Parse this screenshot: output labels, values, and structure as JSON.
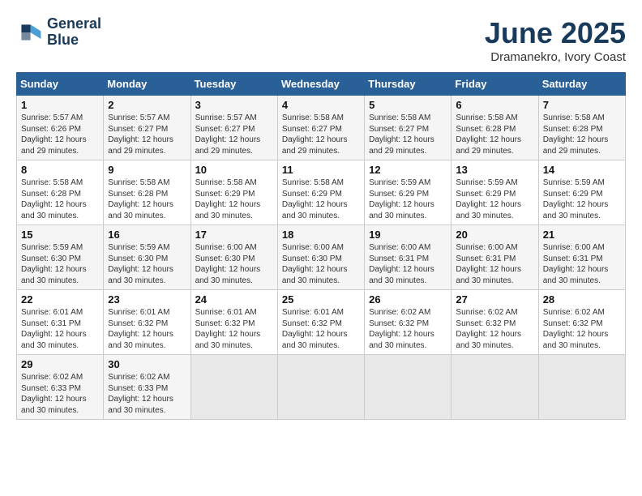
{
  "header": {
    "logo_line1": "General",
    "logo_line2": "Blue",
    "title": "June 2025",
    "subtitle": "Dramanekro, Ivory Coast"
  },
  "days_of_week": [
    "Sunday",
    "Monday",
    "Tuesday",
    "Wednesday",
    "Thursday",
    "Friday",
    "Saturday"
  ],
  "weeks": [
    [
      {
        "day": "1",
        "sunrise": "5:57 AM",
        "sunset": "6:26 PM",
        "daylight": "12 hours and 29 minutes."
      },
      {
        "day": "2",
        "sunrise": "5:57 AM",
        "sunset": "6:27 PM",
        "daylight": "12 hours and 29 minutes."
      },
      {
        "day": "3",
        "sunrise": "5:57 AM",
        "sunset": "6:27 PM",
        "daylight": "12 hours and 29 minutes."
      },
      {
        "day": "4",
        "sunrise": "5:58 AM",
        "sunset": "6:27 PM",
        "daylight": "12 hours and 29 minutes."
      },
      {
        "day": "5",
        "sunrise": "5:58 AM",
        "sunset": "6:27 PM",
        "daylight": "12 hours and 29 minutes."
      },
      {
        "day": "6",
        "sunrise": "5:58 AM",
        "sunset": "6:28 PM",
        "daylight": "12 hours and 29 minutes."
      },
      {
        "day": "7",
        "sunrise": "5:58 AM",
        "sunset": "6:28 PM",
        "daylight": "12 hours and 29 minutes."
      }
    ],
    [
      {
        "day": "8",
        "sunrise": "5:58 AM",
        "sunset": "6:28 PM",
        "daylight": "12 hours and 30 minutes."
      },
      {
        "day": "9",
        "sunrise": "5:58 AM",
        "sunset": "6:28 PM",
        "daylight": "12 hours and 30 minutes."
      },
      {
        "day": "10",
        "sunrise": "5:58 AM",
        "sunset": "6:29 PM",
        "daylight": "12 hours and 30 minutes."
      },
      {
        "day": "11",
        "sunrise": "5:58 AM",
        "sunset": "6:29 PM",
        "daylight": "12 hours and 30 minutes."
      },
      {
        "day": "12",
        "sunrise": "5:59 AM",
        "sunset": "6:29 PM",
        "daylight": "12 hours and 30 minutes."
      },
      {
        "day": "13",
        "sunrise": "5:59 AM",
        "sunset": "6:29 PM",
        "daylight": "12 hours and 30 minutes."
      },
      {
        "day": "14",
        "sunrise": "5:59 AM",
        "sunset": "6:29 PM",
        "daylight": "12 hours and 30 minutes."
      }
    ],
    [
      {
        "day": "15",
        "sunrise": "5:59 AM",
        "sunset": "6:30 PM",
        "daylight": "12 hours and 30 minutes."
      },
      {
        "day": "16",
        "sunrise": "5:59 AM",
        "sunset": "6:30 PM",
        "daylight": "12 hours and 30 minutes."
      },
      {
        "day": "17",
        "sunrise": "6:00 AM",
        "sunset": "6:30 PM",
        "daylight": "12 hours and 30 minutes."
      },
      {
        "day": "18",
        "sunrise": "6:00 AM",
        "sunset": "6:30 PM",
        "daylight": "12 hours and 30 minutes."
      },
      {
        "day": "19",
        "sunrise": "6:00 AM",
        "sunset": "6:31 PM",
        "daylight": "12 hours and 30 minutes."
      },
      {
        "day": "20",
        "sunrise": "6:00 AM",
        "sunset": "6:31 PM",
        "daylight": "12 hours and 30 minutes."
      },
      {
        "day": "21",
        "sunrise": "6:00 AM",
        "sunset": "6:31 PM",
        "daylight": "12 hours and 30 minutes."
      }
    ],
    [
      {
        "day": "22",
        "sunrise": "6:01 AM",
        "sunset": "6:31 PM",
        "daylight": "12 hours and 30 minutes."
      },
      {
        "day": "23",
        "sunrise": "6:01 AM",
        "sunset": "6:32 PM",
        "daylight": "12 hours and 30 minutes."
      },
      {
        "day": "24",
        "sunrise": "6:01 AM",
        "sunset": "6:32 PM",
        "daylight": "12 hours and 30 minutes."
      },
      {
        "day": "25",
        "sunrise": "6:01 AM",
        "sunset": "6:32 PM",
        "daylight": "12 hours and 30 minutes."
      },
      {
        "day": "26",
        "sunrise": "6:02 AM",
        "sunset": "6:32 PM",
        "daylight": "12 hours and 30 minutes."
      },
      {
        "day": "27",
        "sunrise": "6:02 AM",
        "sunset": "6:32 PM",
        "daylight": "12 hours and 30 minutes."
      },
      {
        "day": "28",
        "sunrise": "6:02 AM",
        "sunset": "6:32 PM",
        "daylight": "12 hours and 30 minutes."
      }
    ],
    [
      {
        "day": "29",
        "sunrise": "6:02 AM",
        "sunset": "6:33 PM",
        "daylight": "12 hours and 30 minutes."
      },
      {
        "day": "30",
        "sunrise": "6:02 AM",
        "sunset": "6:33 PM",
        "daylight": "12 hours and 30 minutes."
      },
      {
        "day": "",
        "sunrise": "",
        "sunset": "",
        "daylight": ""
      },
      {
        "day": "",
        "sunrise": "",
        "sunset": "",
        "daylight": ""
      },
      {
        "day": "",
        "sunrise": "",
        "sunset": "",
        "daylight": ""
      },
      {
        "day": "",
        "sunrise": "",
        "sunset": "",
        "daylight": ""
      },
      {
        "day": "",
        "sunrise": "",
        "sunset": "",
        "daylight": ""
      }
    ]
  ]
}
